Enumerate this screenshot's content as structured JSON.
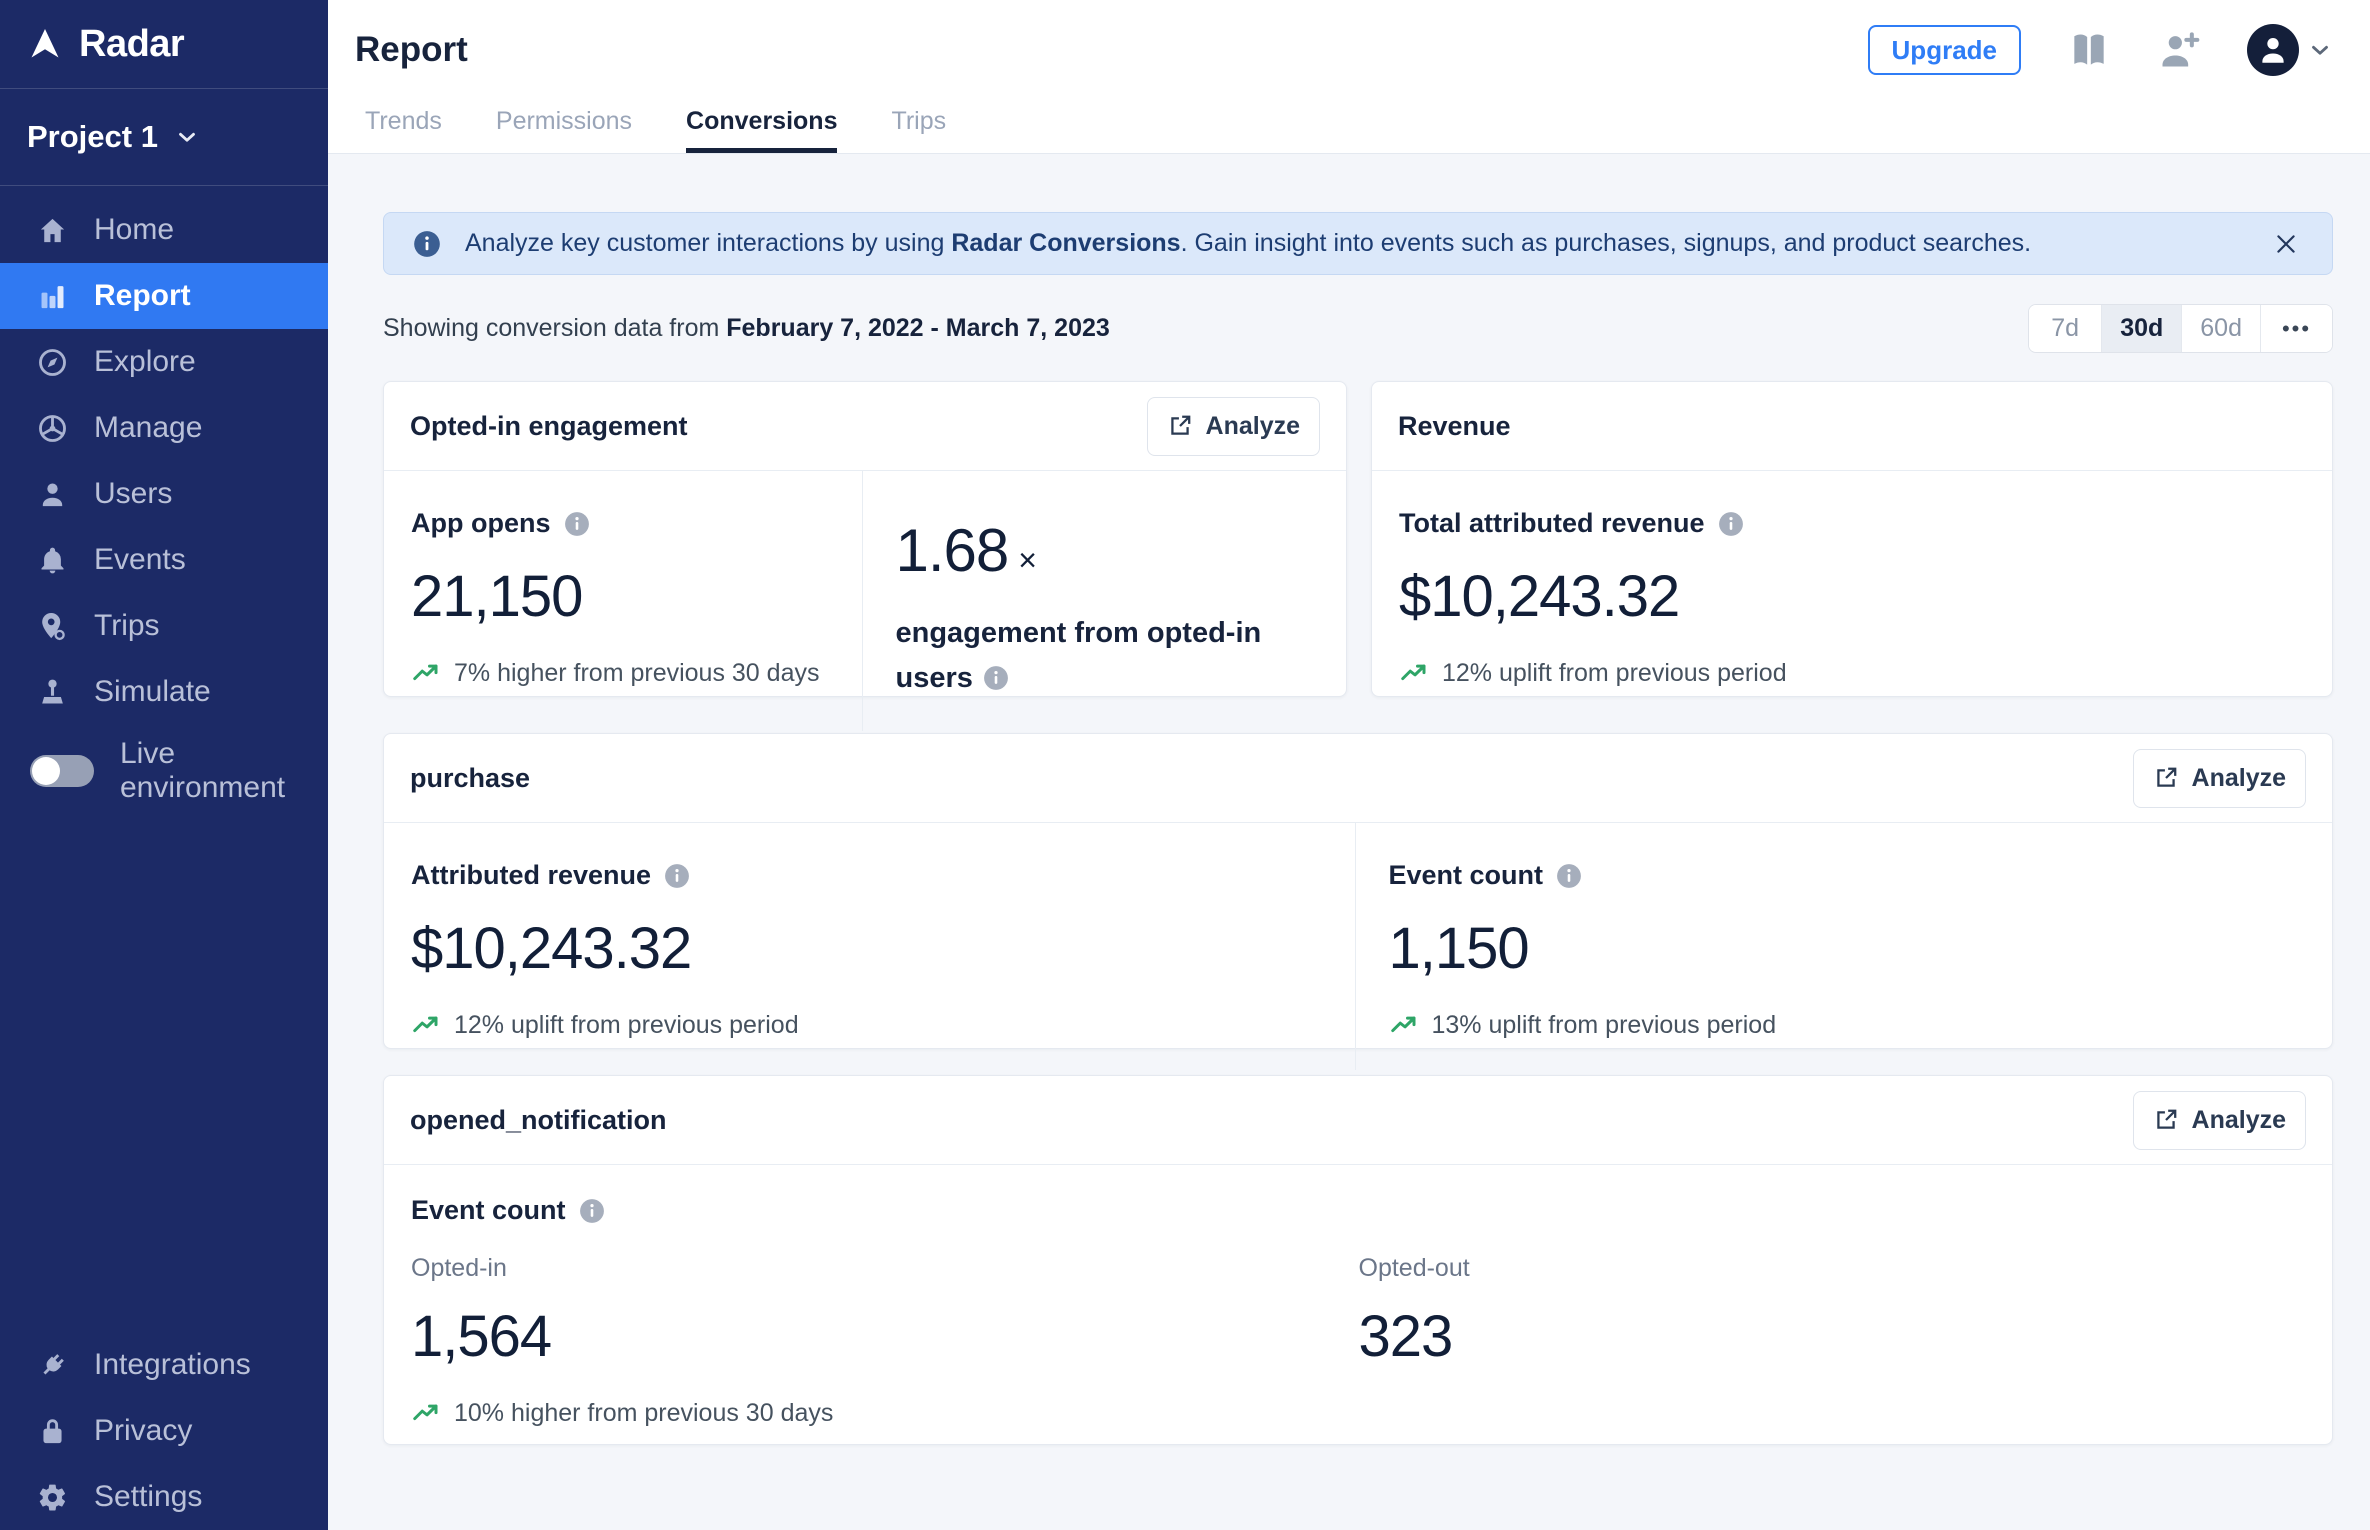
{
  "colors": {
    "sidebar_bg": "#1c2a66",
    "accent_blue": "#3079f2",
    "banner_bg": "#dbe8fa",
    "trend_green": "#2ea567",
    "dark_text": "#17233c",
    "page_bg": "#f4f6fa"
  },
  "sidebar": {
    "logo": "Radar",
    "project": "Project 1",
    "items": [
      {
        "label": "Home"
      },
      {
        "label": "Report"
      },
      {
        "label": "Explore"
      },
      {
        "label": "Manage"
      },
      {
        "label": "Users"
      },
      {
        "label": "Events"
      },
      {
        "label": "Trips"
      },
      {
        "label": "Simulate"
      }
    ],
    "toggle_label": "Live environment",
    "bottom_items": [
      {
        "label": "Integrations"
      },
      {
        "label": "Privacy"
      },
      {
        "label": "Settings"
      }
    ]
  },
  "header": {
    "title": "Report",
    "upgrade_label": "Upgrade",
    "tabs": [
      {
        "label": "Trends"
      },
      {
        "label": "Permissions"
      },
      {
        "label": "Conversions"
      },
      {
        "label": "Trips"
      }
    ],
    "active_tab": "Conversions"
  },
  "banner": {
    "prefix": "Analyze key customer interactions by using ",
    "bold": "Radar Conversions",
    "suffix": ". Gain insight into events such as purchases, signups, and product searches."
  },
  "filters": {
    "showing_prefix": "Showing conversion data from ",
    "date_range": "February 7, 2022 - March 7, 2023",
    "options": [
      {
        "label": "7d"
      },
      {
        "label": "30d"
      },
      {
        "label": "60d"
      }
    ],
    "active_option": "30d",
    "more_label": "•••"
  },
  "cards": {
    "engagement": {
      "title": "Opted-in engagement",
      "analyze_label": "Analyze",
      "app_opens": {
        "label": "App opens",
        "value": "21,150",
        "trend": "7% higher from previous 30 days"
      },
      "multiplier": {
        "value": "1.68",
        "times": "×",
        "label_line": "engagement from opted-in users"
      }
    },
    "revenue": {
      "title": "Revenue",
      "metric": {
        "label": "Total attributed revenue",
        "value": "$10,243.32",
        "trend": "12% uplift from previous period"
      }
    },
    "purchase": {
      "title": "purchase",
      "analyze_label": "Analyze",
      "attributed_revenue": {
        "label": "Attributed revenue",
        "value": "$10,243.32",
        "trend": "12% uplift from previous period"
      },
      "event_count": {
        "label": "Event count",
        "value": "1,150",
        "trend": "13% uplift from previous period"
      }
    },
    "opened_notification": {
      "title": "opened_notification",
      "analyze_label": "Analyze",
      "metric_label": "Event count",
      "opted_in": {
        "label": "Opted-in",
        "value": "1,564",
        "trend": "10% higher from previous 30 days"
      },
      "opted_out": {
        "label": "Opted-out",
        "value": "323"
      }
    }
  }
}
